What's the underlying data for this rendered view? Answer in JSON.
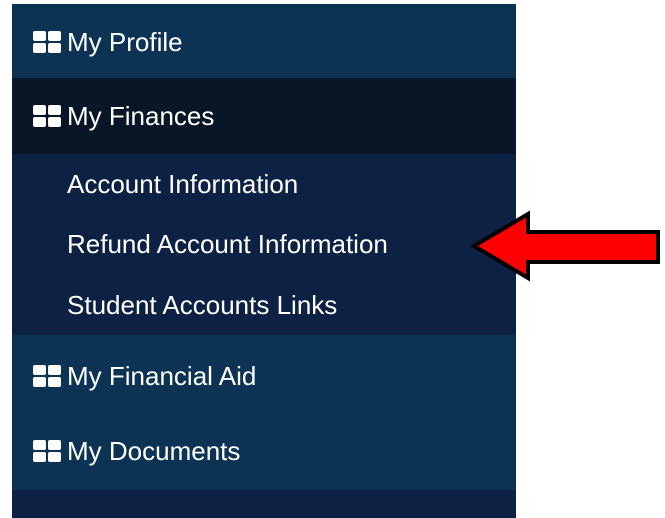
{
  "sidebar": {
    "items": [
      {
        "label": "My Profile",
        "icon": "grid-icon"
      },
      {
        "label": "My Finances",
        "icon": "grid-icon",
        "expanded": true
      },
      {
        "label": "My Financial Aid",
        "icon": "grid-icon"
      },
      {
        "label": "My Documents",
        "icon": "grid-icon"
      }
    ],
    "finances_submenu": [
      {
        "label": "Account Information"
      },
      {
        "label": "Refund Account Information",
        "highlighted": true
      },
      {
        "label": "Student Accounts Links"
      }
    ]
  },
  "annotation": {
    "arrow_color": "#ff0000",
    "arrow_direction": "left",
    "points_to": "Refund Account Information"
  },
  "colors": {
    "sidebar_bg": "#0d3354",
    "active_bg": "#081627",
    "submenu_bg": "#0d2145",
    "text": "#ffffff"
  }
}
